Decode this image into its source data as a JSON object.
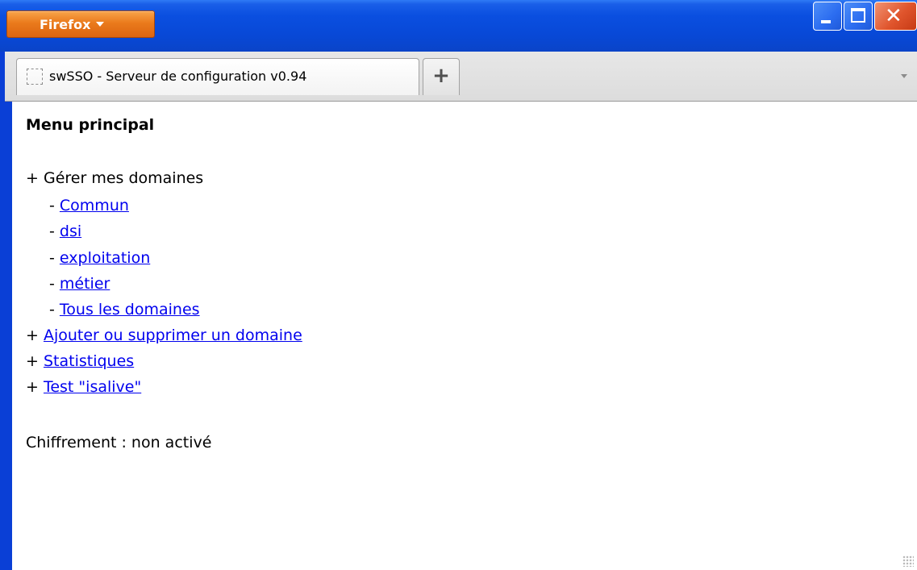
{
  "browser": {
    "menu_button_label": "Firefox",
    "tab_title": "swSSO - Serveur de configuration v0.94",
    "new_tab_label": "+"
  },
  "page": {
    "heading": "Menu principal",
    "manage_domains": {
      "prefix": "+",
      "label": "Gérer mes domaines",
      "items": [
        {
          "prefix": "-",
          "label": "Commun"
        },
        {
          "prefix": "-",
          "label": "dsi"
        },
        {
          "prefix": "-",
          "label": "exploitation"
        },
        {
          "prefix": "-",
          "label": "métier"
        },
        {
          "prefix": "-",
          "label": "Tous les domaines"
        }
      ]
    },
    "links": [
      {
        "prefix": "+",
        "label": "Ajouter ou supprimer un domaine"
      },
      {
        "prefix": "+",
        "label": "Statistiques"
      },
      {
        "prefix": "+",
        "label": "Test \"isalive\""
      }
    ],
    "encryption_status": "Chiffrement : non activé"
  },
  "colors": {
    "titlebar": "#0a4fe0",
    "firefox_button": "#e8741a",
    "close_button": "#e0552d",
    "link": "#0000ee"
  },
  "icons": [
    "dropdown-arrow-icon",
    "minimize-icon",
    "maximize-icon",
    "close-icon",
    "page-favicon-icon",
    "plus-icon",
    "tab-list-arrow-icon",
    "resize-grip-icon"
  ]
}
